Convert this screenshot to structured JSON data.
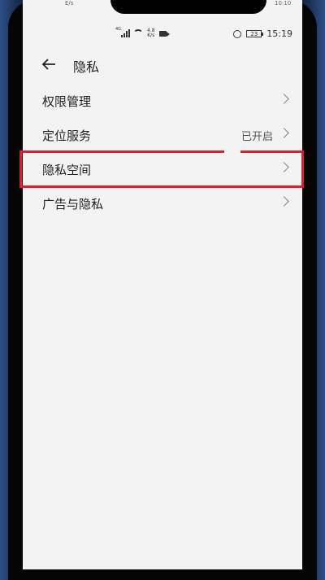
{
  "status": {
    "top_left_ghost": "E/s",
    "top_right_ghost": "10:10",
    "network": "4G",
    "speed_value": "4.8",
    "speed_unit": "K/s",
    "battery": "23",
    "time": "15:19"
  },
  "header": {
    "title": "隐私"
  },
  "menu": {
    "items": [
      {
        "label": "权限管理",
        "value": ""
      },
      {
        "label": "定位服务",
        "value": "已开启"
      },
      {
        "label": "隐私空间",
        "value": ""
      },
      {
        "label": "广告与隐私",
        "value": ""
      }
    ]
  },
  "colors": {
    "highlight": "#e11d2b",
    "background": "#f3f3f3"
  }
}
